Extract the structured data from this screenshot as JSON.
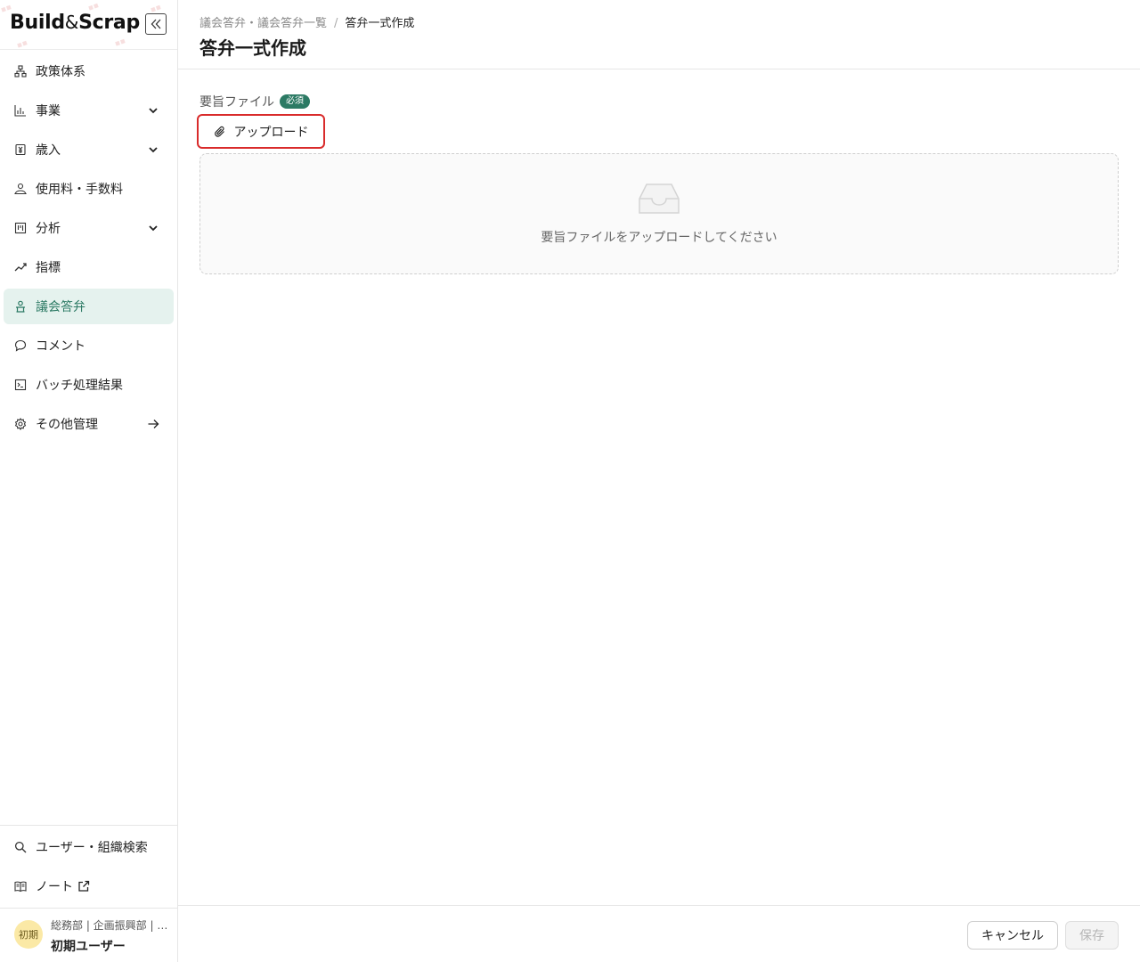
{
  "app": {
    "logo_left": "Build",
    "logo_amp": "&",
    "logo_right": "Scrap"
  },
  "sidebar": {
    "items": [
      {
        "label": "政策体系",
        "icon": "sitemap-icon"
      },
      {
        "label": "事業",
        "icon": "bar-chart-icon",
        "trail": "chevron-down-icon"
      },
      {
        "label": "歳入",
        "icon": "revenue-icon",
        "trail": "chevron-down-icon"
      },
      {
        "label": "使用料・手数料",
        "icon": "fee-icon"
      },
      {
        "label": "分析",
        "icon": "analysis-icon",
        "trail": "chevron-down-icon"
      },
      {
        "label": "指標",
        "icon": "trend-icon"
      },
      {
        "label": "議会答弁",
        "icon": "podium-icon",
        "active": true
      },
      {
        "label": "コメント",
        "icon": "comment-icon"
      },
      {
        "label": "バッチ処理結果",
        "icon": "terminal-icon"
      },
      {
        "label": "その他管理",
        "icon": "gear-icon",
        "trail": "arrow-right-icon"
      }
    ],
    "bottom_items": [
      {
        "label": "ユーザー・組織検索",
        "icon": "search-icon"
      },
      {
        "label": "ノート",
        "icon": "book-icon",
        "trail": "external-link-icon"
      }
    ],
    "user": {
      "avatar": "初期",
      "org": "総務部 | 企画振興部 | …",
      "name": "初期ユーザー"
    }
  },
  "header": {
    "breadcrumb_parent": "議会答弁・議会答弁一覧",
    "breadcrumb_sep": "/",
    "breadcrumb_current": "答弁一式作成",
    "title": "答弁一式作成"
  },
  "main": {
    "field_label": "要旨ファイル",
    "required_badge": "必須",
    "upload_label": "アップロード",
    "empty_text": "要旨ファイルをアップロードしてください"
  },
  "footer": {
    "cancel_label": "キャンセル",
    "save_label": "保存"
  },
  "colors": {
    "accent": "#2c7a64",
    "active_bg": "#e5f2ee",
    "highlight": "#d92b2b"
  }
}
